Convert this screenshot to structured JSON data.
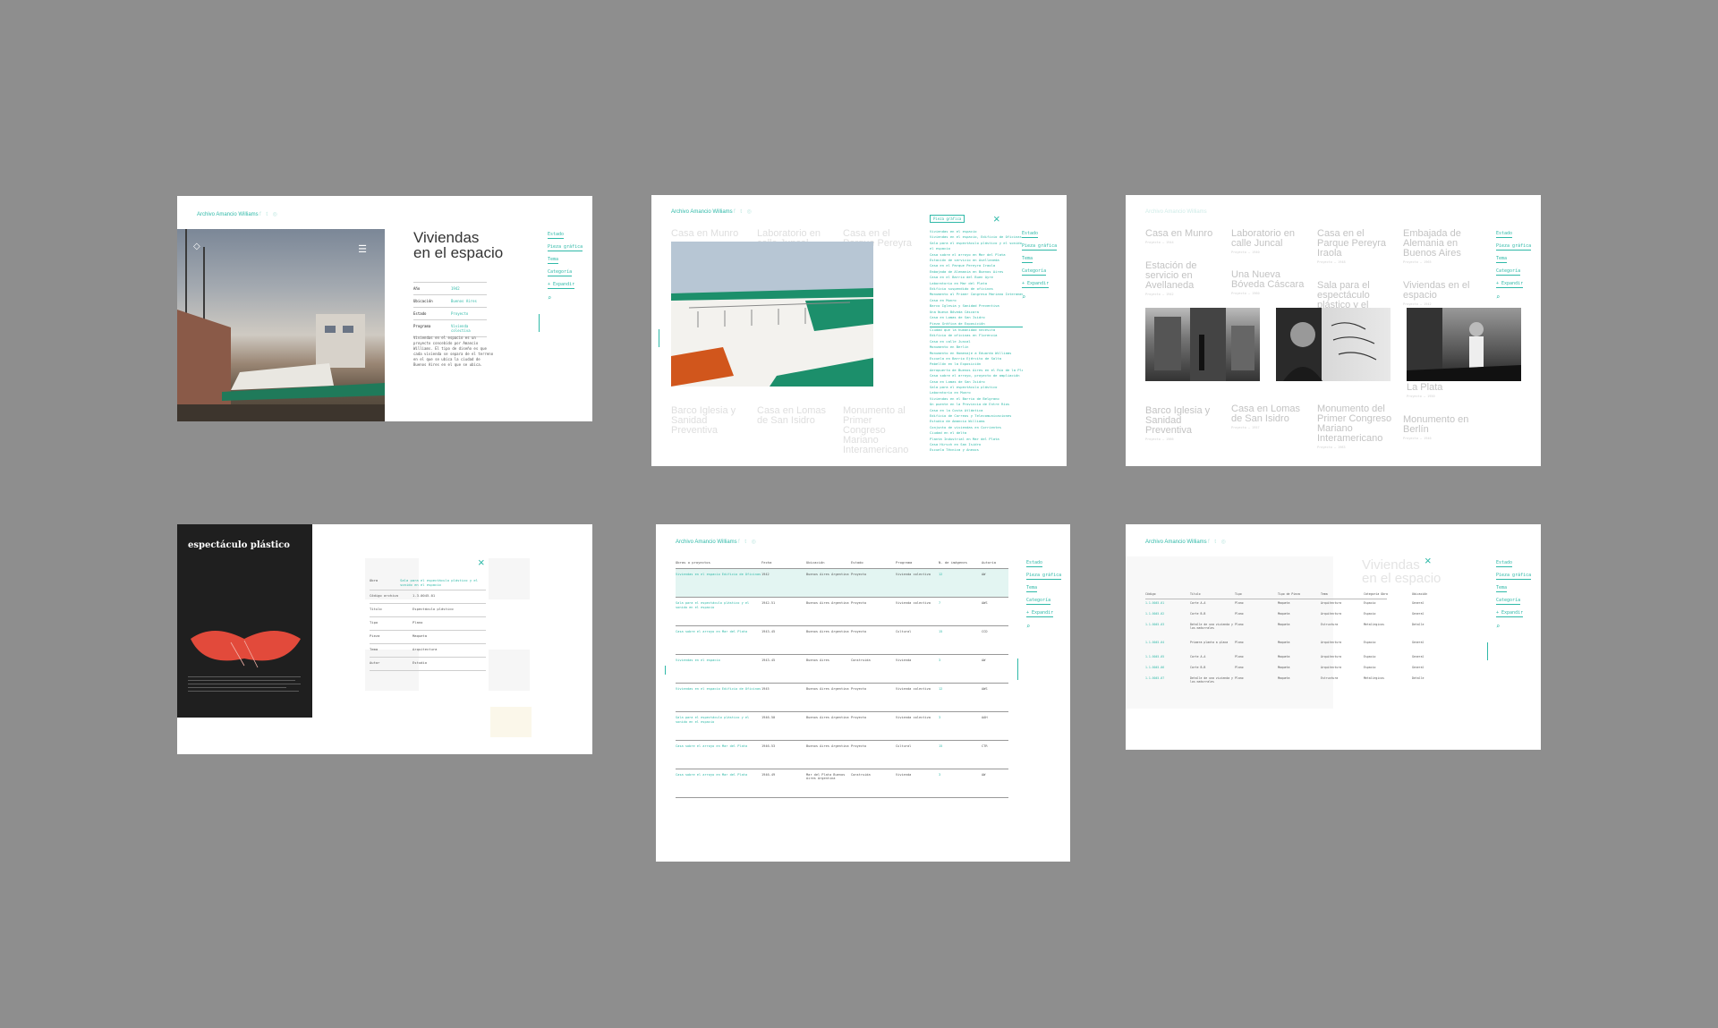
{
  "brand": "Archivo Amancio Williams",
  "social_icons": [
    "facebook-icon",
    "twitter-icon",
    "instagram-icon"
  ],
  "accent": "#2fb9a8",
  "background": "#8e8e8e",
  "nav": [
    "Estado",
    "Pieza gráfica",
    "Tema",
    "Categoría",
    "+ Expandir"
  ],
  "frame1": {
    "title_line1": "Viviendas",
    "title_line2": "en el espacio",
    "table": [
      {
        "k": "Año",
        "v": "1942"
      },
      {
        "k": "Ubicación",
        "v": "Buenos Aires"
      },
      {
        "k": "Estado",
        "v": "Proyecto"
      },
      {
        "k": "Programa",
        "v": "Vivienda colectiva"
      }
    ],
    "desc": "Viviendas en el espacio es un proyecto concebido por Amancio Williams. El tipo de diseño es que cada vivienda se separa de el terreno en el que se ubica la ciudad de Buenos Aires en el que se ubica."
  },
  "frame2": {
    "filter_label": "Pieza gráfica",
    "list": [
      "Viviendas en el espacio",
      "Viviendas en el espacio, Edificio de Oficinas",
      "Sala para el espectáculo plástico y el sonido en",
      "el espacio",
      "Casa sobre el arroyo en Mar del Plata",
      "Estación de servicio en Avellaneda",
      "Casa en el Parque Pereyra Iraola",
      "Embajada de Alemania en Buenos Aires",
      "Casa en el Barrio del Buen Ayre",
      "Laboratorio en Mar del Plata",
      "Edificio suspendido de oficinas",
      "Monumento al Primer Congreso Mariano Interamericano",
      "Casa en Munro",
      "Barco Iglesia y Sanidad Preventiva",
      "Una Nueva Bóveda Cáscara",
      "Casa en Lomas de San Isidro",
      "Pieza Gráfica de Exposición",
      "Ciudad que la humanidad necesita",
      "Edificio de oficinas en Florencia",
      "Casa en calle Juncal",
      "Monumento en Berlín",
      "Monumento en Homenaje a Eduardo Williams",
      "Escuela en Barrio Ejército de Salta",
      "Pabellón en la Exposición",
      "Aeropuerto de Buenos Aires en el Río de la Plata",
      "Casa sobre el arroyo, proyecto de ampliación",
      "Casa en Lomas de San Isidro",
      "Sala para el espectáculo plástico",
      "Laboratorio en Munro",
      "Viviendas en el Barrio de Belgrano",
      "Un puente en la Provincia de Entre Ríos",
      "Casa en la Costa Atlántica",
      "Edificio de Correos y Telecomunicaciones",
      "Estudio de Amancio Williams",
      "Conjunto de viviendas en Corrientes",
      "Ciudad en el delta",
      "Planta Industrial en Mar del Plata",
      "Casa Hirsch en San Isidro",
      "Escuela Técnica y Anexos"
    ],
    "ghost_titles": [
      "Casa en Munro",
      "Laboratorio en calle Juncal",
      "Casa en el Parque Pereyra",
      "Barco Iglesia y Sanidad Preventiva",
      "Casa en Lomas de San Isidro",
      "Monumento al Primer Congreso Mariano Interamericano"
    ]
  },
  "frame3": {
    "items": [
      {
        "t": "Casa en Munro",
        "m": "Proyecto — 1944"
      },
      {
        "t": "Laboratorio en calle Juncal",
        "m": "Proyecto — 1940"
      },
      {
        "t": "Casa en el Parque Pereyra Iraola",
        "m": "Proyecto — 1948"
      },
      {
        "t": "Embajada de Alemania en Buenos Aires",
        "m": "Proyecto — 1965"
      },
      {
        "t": "Estación de servicio en Avellaneda",
        "m": "Proyecto — 1942"
      },
      {
        "t": "Una Nueva Bóveda Cáscara",
        "m": "Proyecto — 1960"
      },
      {
        "t": "Sala para el espectáculo plástico y el sonido",
        "m": "Proyecto — 1942"
      },
      {
        "t": "Viviendas en el espacio",
        "m": "Proyecto — 1942"
      },
      {
        "t": "La Plata",
        "m": "Proyecto — 1950"
      },
      {
        "t": "Barco Iglesia y Sanidad Preventiva",
        "m": "Proyecto — 1966"
      },
      {
        "t": "Casa en Lomas de San Isidro",
        "m": "Proyecto — 1957"
      },
      {
        "t": "Monumento del Primer Congreso Mariano Interamericano",
        "m": "Proyecto — 1983"
      },
      {
        "t": "Monumento en Berlín",
        "m": "Proyecto — 1946"
      }
    ]
  },
  "frame4": {
    "poster_title": "espectáculo plástico",
    "table": [
      {
        "k": "Obra",
        "v": "Sala para el espectáculo plástico y el sonido en el espacio",
        "teal": true
      },
      {
        "k": "Código archivo",
        "v": "1.3.0045.01",
        "teal": false
      },
      {
        "k": "Título",
        "v": "Espectáculo plástico",
        "teal": false
      },
      {
        "k": "Tipo",
        "v": "Plano",
        "teal": false
      },
      {
        "k": "Pieza",
        "v": "Maqueta",
        "teal": false
      },
      {
        "k": "Tema",
        "v": "Arquitectura",
        "teal": false
      },
      {
        "k": "Autor",
        "v": "Estudio",
        "teal": false
      }
    ]
  },
  "frame5": {
    "headers": [
      "Obras o proyectos",
      "Fecha",
      "Ubicación",
      "Estado",
      "Programa",
      "N. de imágenes",
      "Autoría"
    ],
    "rows": [
      {
        "c": [
          "Viviendas en el espacio Edificio de Oficinas",
          "1942",
          "Buenos Aires Argentina",
          "Proyecto",
          "Vivienda colectiva",
          "12",
          "AW"
        ],
        "hl": true
      },
      {
        "c": [
          "Sala para el espectáculo plástico y el sonido en el espacio",
          "1942-51",
          "Buenos Aires Argentina",
          "Proyecto",
          "Vivienda colectiva",
          "7",
          "AWS"
        ],
        "hl": false
      },
      {
        "c": [
          "Casa sobre el arroyo en Mar del Plata",
          "1943-45",
          "Buenos Aires Argentina",
          "Proyecto",
          "Cultural",
          "15",
          "CCD"
        ],
        "hl": false
      },
      {
        "c": [
          "Viviendas en el espacio",
          "1943-45",
          "Buenos Aires",
          "Construida",
          "Vivienda",
          "3",
          "AW"
        ],
        "hl": false
      },
      {
        "c": [
          "Viviendas en el espacio Edificio de Oficinas",
          "1945",
          "Buenos Aires Argentina",
          "Proyecto",
          "Vivienda colectiva",
          "12",
          "AWS"
        ],
        "hl": false
      },
      {
        "c": [
          "Sala para el espectáculo plástico y el sonido en el espacio",
          "1946-50",
          "Buenos Aires Argentina",
          "Proyecto",
          "Vivienda colectiva",
          "3",
          "AAH"
        ],
        "hl": false
      },
      {
        "c": [
          "Casa sobre el arroyo en Mar del Plata",
          "1946-53",
          "Buenos Aires Argentina",
          "Proyecto",
          "Cultural",
          "15",
          "CTR"
        ],
        "hl": false
      },
      {
        "c": [
          "Casa sobre el arroyo en Mar del Plata",
          "1946-49",
          "Mar del Plata Buenos Aires Argentina",
          "Construida",
          "Vivienda",
          "3",
          "AW"
        ],
        "hl": false
      }
    ]
  },
  "frame6": {
    "ghost_title_line1": "Viviendas",
    "ghost_title_line2": "en el espacio",
    "headers": [
      "Código",
      "Título",
      "Tipo",
      "Tipo de Pieza",
      "Tema",
      "Categoría Obra",
      "Ubicación"
    ],
    "rows": [
      [
        "1.1.0045.01",
        "Corte A-A",
        "Plano",
        "Maqueta",
        "Arquitectura",
        "Espacio",
        "General"
      ],
      [
        "1.1.0045.02",
        "Corte B-B",
        "Plano",
        "Maqueta",
        "Arquitectura",
        "Espacio",
        "General"
      ],
      [
        "1.1.0045.03",
        "Detalle de una vivienda y los matorrales",
        "Plano",
        "Maqueta",
        "Estructura",
        "Metalúrgicos",
        "Detalle"
      ],
      [
        "1.1.0045.04",
        "Primera planta a placa",
        "Plano",
        "Maqueta",
        "Arquitectura",
        "Espacio",
        "General"
      ],
      [
        "1.1.0045.05",
        "Corte A-A",
        "Plano",
        "Maqueta",
        "Arquitectura",
        "Espacio",
        "General"
      ],
      [
        "1.1.0045.06",
        "Corte B-B",
        "Plano",
        "Maqueta",
        "Arquitectura",
        "Espacio",
        "General"
      ],
      [
        "1.1.0045.07",
        "Detalle de una vivienda y los matorrales",
        "Plano",
        "Maqueta",
        "Estructura",
        "Metalúrgicos",
        "Detalle"
      ]
    ]
  }
}
